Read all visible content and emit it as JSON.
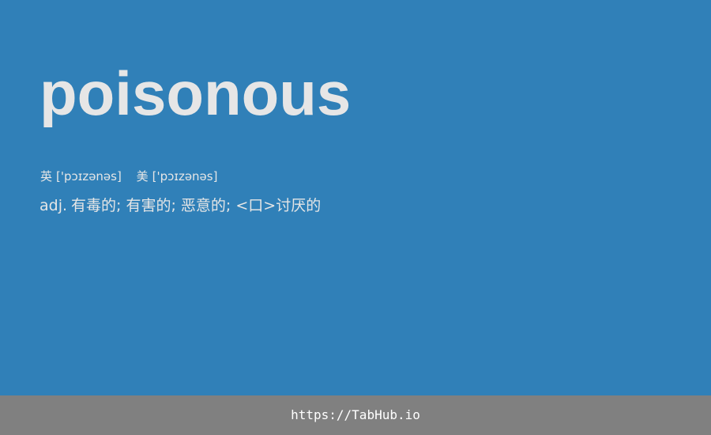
{
  "colors": {
    "background": "#3080b8",
    "text": "#e6e6e6",
    "footer_background": "#808080",
    "footer_text": "#ffffff"
  },
  "entry": {
    "word": "poisonous",
    "phonetics": {
      "uk": {
        "region": "英",
        "ipa": "['pɔɪzənəs]"
      },
      "us": {
        "region": "美",
        "ipa": "['pɔɪzənəs]"
      }
    },
    "definition": {
      "pos": "adj.",
      "meaning": "有毒的; 有害的; 恶意的; <口>讨厌的"
    }
  },
  "footer": {
    "link_text": "https://TabHub.io"
  }
}
